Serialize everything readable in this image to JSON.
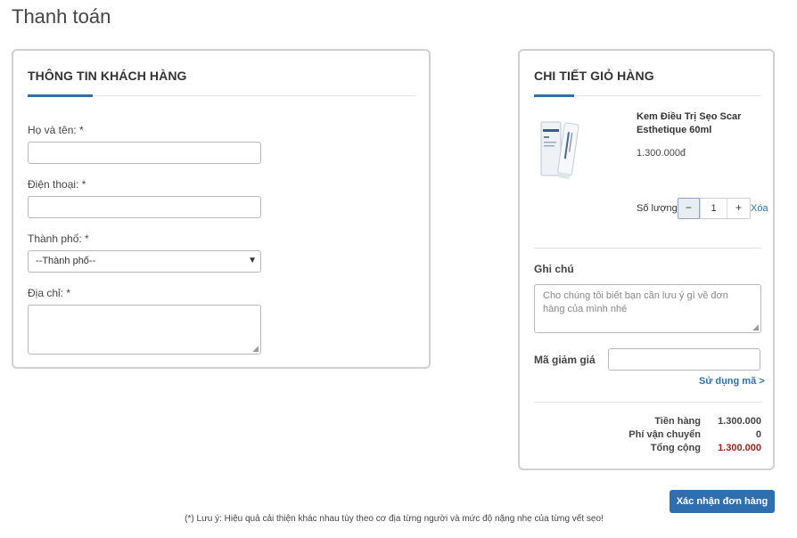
{
  "page": {
    "title": "Thanh toán"
  },
  "customer": {
    "heading": "THÔNG TIN KHÁCH HÀNG",
    "name_label": "Họ và tên: *",
    "name_value": "",
    "phone_label": "Điện thoại: *",
    "phone_value": "",
    "city_label": "Thành phố: *",
    "city_selected": "--Thành phố--",
    "address_label": "Địa chỉ: *",
    "address_value": ""
  },
  "cart": {
    "heading": "CHI TIẾT GIỎ HÀNG",
    "item": {
      "name": "Kem Điều Trị Sẹo Scar Esthetique 60ml",
      "price": "1.300.000đ",
      "image_icon": "product-tube-image"
    },
    "qty_label": "Số lượng:",
    "qty_minus": "−",
    "qty_value": "1",
    "qty_plus": "+",
    "remove_label": "Xóa",
    "note_label": "Ghi chú",
    "note_placeholder": "Cho chúng tôi biết bạn cần lưu ý gì về đơn hàng của mình nhé",
    "coupon_label": "Mã giảm giá",
    "coupon_value": "",
    "apply_label": "Sử dụng mã >",
    "summary": {
      "subtotal_label": "Tiền hàng",
      "subtotal_value": "1.300.000",
      "shipping_label": "Phí vận chuyển",
      "shipping_value": "0",
      "total_label": "Tổng cộng",
      "total_value": "1.300.000"
    }
  },
  "actions": {
    "confirm_label": "Xác nhận đơn hàng"
  },
  "footer": {
    "note": "(*) Lưu ý: Hiệu quả cải thiện khác nhau tùy theo cơ địa từng người và mức độ nặng nhẹ của từng vết sẹo!"
  },
  "colors": {
    "accent": "#2f6fb0",
    "total": "#a51f1f",
    "border": "#d0d0d0"
  }
}
